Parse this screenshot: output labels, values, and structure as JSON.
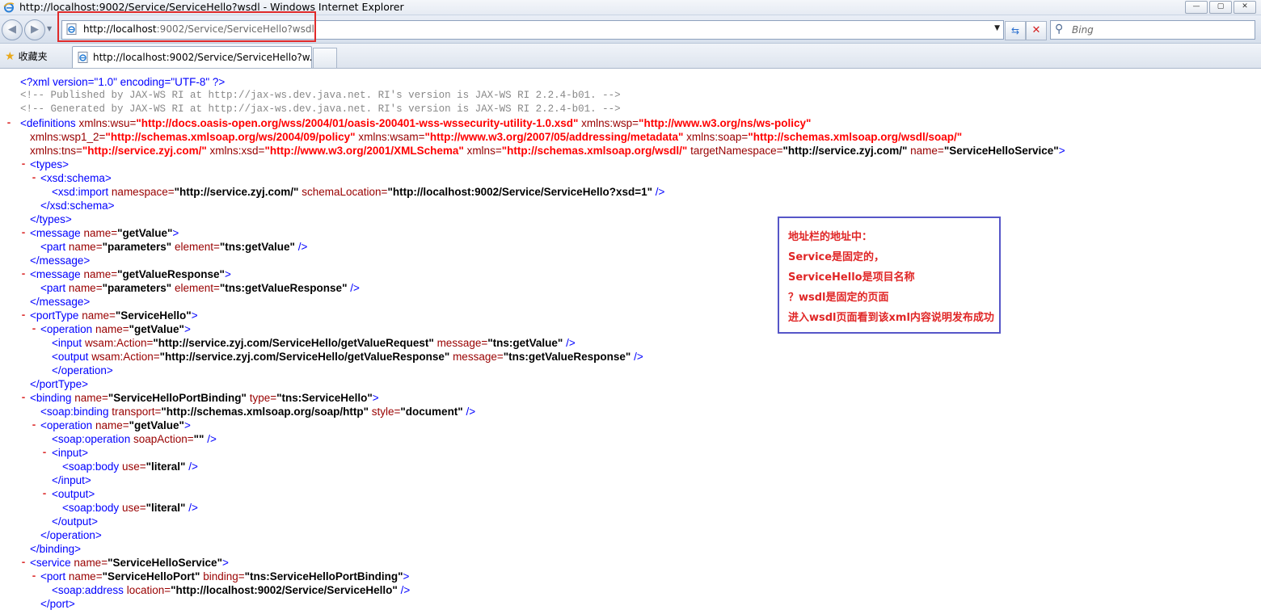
{
  "window": {
    "title": "http://localhost:9002/Service/ServiceHello?wsdl - Windows Internet Explorer",
    "controls": [
      "—",
      "▢",
      "✕"
    ]
  },
  "navbar": {
    "address_host": "http://localhost",
    "address_rest": ":9002/Service/ServiceHello?wsdl",
    "search_placeholder": "Bing"
  },
  "tabs": {
    "favorites_label": "收藏夹",
    "active_tab": "http://localhost:9002/Service/ServiceHello?w..."
  },
  "colors": {
    "tag": "#0000ff",
    "attr_name": "#990000",
    "attr_value_url": "#ff0000",
    "annotation_text": "#e02626",
    "annotation_border": "#5656c8",
    "address_highlight": "#e02a2a"
  },
  "xml": {
    "decl": "<?xml version=\"1.0\" encoding=\"UTF-8\" ?>",
    "comment1": "<!--  Published by JAX-WS RI at http://jax-ws.dev.java.net. RI's version is JAX-WS RI 2.2.4-b01.  -->",
    "comment2": "<!--  Generated by JAX-WS RI at http://jax-ws.dev.java.net. RI's version is JAX-WS RI 2.2.4-b01.  -->",
    "toggle": "-",
    "defs": {
      "open": "<definitions",
      "wsu_n": "xmlns:wsu=",
      "wsu_v": "\"http://docs.oasis-open.org/wss/2004/01/oasis-200401-wss-wssecurity-utility-1.0.xsd\"",
      "wsp_n": "xmlns:wsp=",
      "wsp_v": "\"http://www.w3.org/ns/ws-policy\"",
      "wsp12_n": "xmlns:wsp1_2=",
      "wsp12_v": "\"http://schemas.xmlsoap.org/ws/2004/09/policy\"",
      "wsam_n": "xmlns:wsam=",
      "wsam_v": "\"http://www.w3.org/2007/05/addressing/metadata\"",
      "soap_n": "xmlns:soap=",
      "soap_v": "\"http://schemas.xmlsoap.org/wsdl/soap/\"",
      "tns_n": "xmlns:tns=",
      "tns_v": "\"http://service.zyj.com/\"",
      "xsd_n": "xmlns:xsd=",
      "xsd_v": "\"http://www.w3.org/2001/XMLSchema\"",
      "xmlns_n": "xmlns=",
      "xmlns_v": "\"http://schemas.xmlsoap.org/wsdl/\"",
      "tgt_n": "targetNamespace=",
      "tgt_v": "\"http://service.zyj.com/\"",
      "name_n": "name=",
      "name_v": "\"ServiceHelloService\"",
      "close": ">"
    },
    "types_open": "<types>",
    "schema_open": "<xsd:schema>",
    "import_tag": "<xsd:import",
    "import_ns_n": "namespace=",
    "import_ns_v": "\"http://service.zyj.com/\"",
    "import_loc_n": "schemaLocation=",
    "import_loc_v": "\"http://localhost:9002/Service/ServiceHello?xsd=1\"",
    "selfclose": "/>",
    "schema_close": "</xsd:schema>",
    "types_close": "</types>",
    "msg_tag": "<message",
    "name_attr": "name=",
    "msg1_name": "\"getValue\"",
    "part_tag": "<part",
    "part_name": "\"parameters\"",
    "element_attr": "element=",
    "part1_el": "\"tns:getValue\"",
    "msg_close": "</message>",
    "msg2_name": "\"getValueResponse\"",
    "part2_el": "\"tns:getValueResponse\"",
    "porttype_tag": "<portType",
    "porttype_name": "\"ServiceHello\"",
    "op_tag": "<operation",
    "op_name": "\"getValue\"",
    "input_tag": "<input",
    "output_tag": "<output",
    "action_attr": "wsam:Action=",
    "in_action": "\"http://service.zyj.com/ServiceHello/getValueRequest\"",
    "out_action": "\"http://service.zyj.com/ServiceHello/getValueResponse\"",
    "message_attr": "message=",
    "in_msg": "\"tns:getValue\"",
    "out_msg": "\"tns:getValueResponse\"",
    "op_close": "</operation>",
    "porttype_close": "</portType>",
    "binding_tag": "<binding",
    "binding_name": "\"ServiceHelloPortBinding\"",
    "type_attr": "type=",
    "binding_type": "\"tns:ServiceHello\"",
    "soapbinding_tag": "<soap:binding",
    "transport_attr": "transport=",
    "transport_v": "\"http://schemas.xmlsoap.org/soap/http\"",
    "style_attr": "style=",
    "style_v": "\"document\"",
    "soapop_tag": "<soap:operation",
    "soapaction_attr": "soapAction=",
    "soapaction_v": "\"\"",
    "input_open": "<input>",
    "soapbody_tag": "<soap:body",
    "use_attr": "use=",
    "use_v": "\"literal\"",
    "input_close": "</input>",
    "output_open": "<output>",
    "output_close": "</output>",
    "binding_close": "</binding>",
    "service_tag": "<service",
    "service_name": "\"ServiceHelloService\"",
    "port_tag": "<port",
    "port_name": "\"ServiceHelloPort\"",
    "binding_attr": "binding=",
    "port_binding": "\"tns:ServiceHelloPortBinding\"",
    "soapaddr_tag": "<soap:address",
    "location_attr": "location=",
    "location_v": "\"http://localhost:9002/Service/ServiceHello\"",
    "port_close": "</port>",
    "gt": ">"
  },
  "note": {
    "line1": "地址栏的地址中：",
    "line2": "Service是固定的，",
    "line3": "ServiceHello是项目名称",
    "line4": "？wsdl是固定的页面",
    "line5": "进入wsdl页面看到该xml内容说明发布成功"
  }
}
